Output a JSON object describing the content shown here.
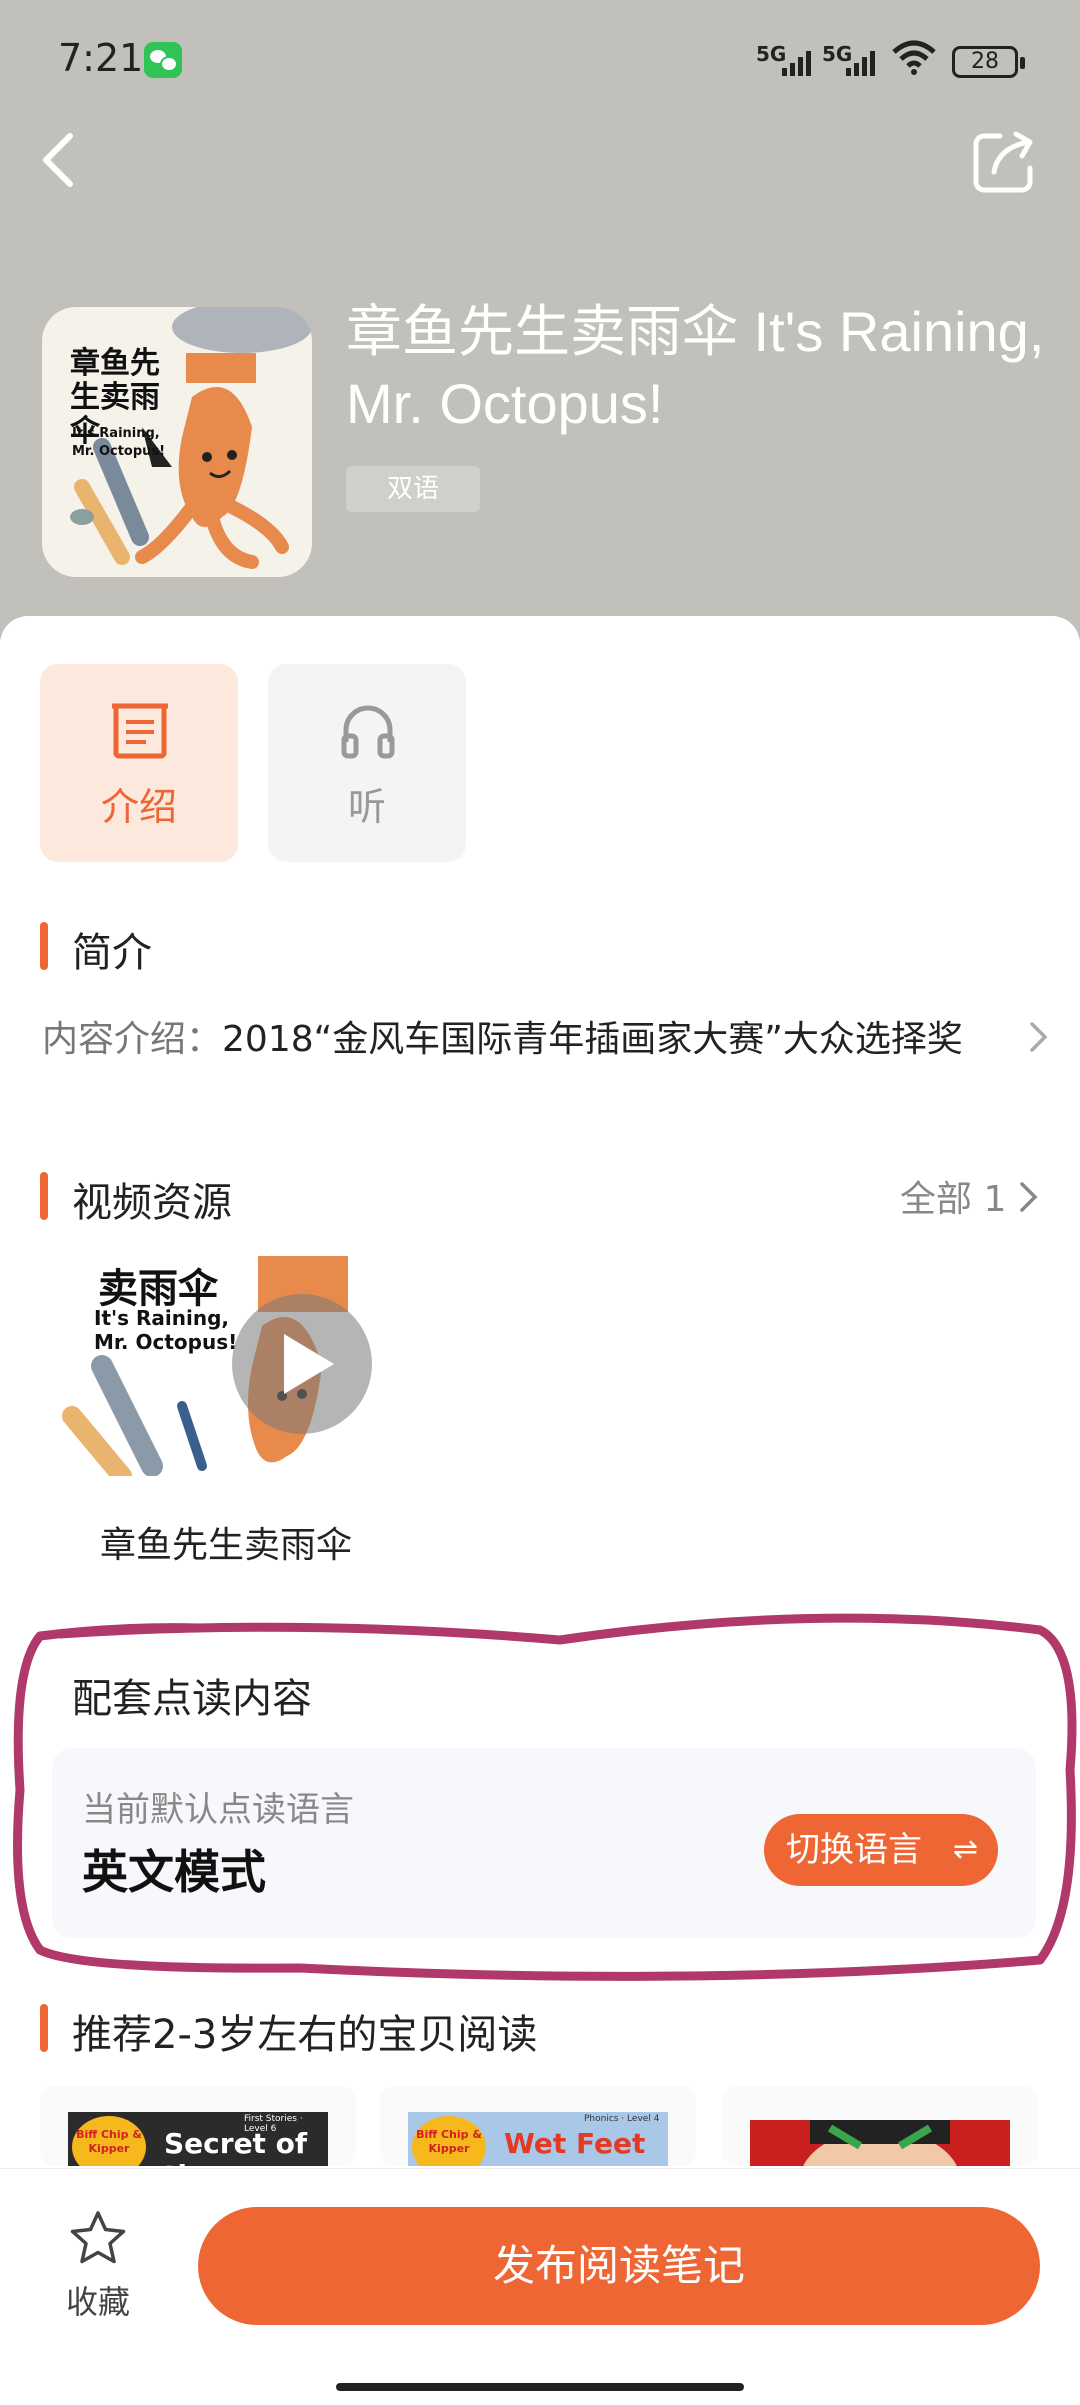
{
  "status_bar": {
    "time": "7:21",
    "signal1": "5G",
    "signal2": "5G",
    "battery": "28"
  },
  "book": {
    "title": "章鱼先生卖雨伞 It's Raining, Mr. Octopus!",
    "tag": "双语",
    "cover_title_cn": "章鱼先生卖雨伞",
    "cover_title_en": "It's Raining, Mr. Octopus!"
  },
  "tabs": [
    {
      "label": "介绍",
      "icon": "document-icon",
      "active": true
    },
    {
      "label": "听",
      "icon": "headphones-icon",
      "active": false
    }
  ],
  "intro": {
    "section_title": "简介",
    "label": "内容介绍：",
    "text": "2018“金风车国际青年插画家大赛”大众选择奖"
  },
  "videos": {
    "section_title": "视频资源",
    "all_label": "全部 1",
    "thumb_title_cn": "卖雨伞",
    "thumb_title_en": "It's Raining, Mr. Octopus!",
    "caption": "章鱼先生卖雨伞"
  },
  "read_point": {
    "section_title": "配套点读内容",
    "subtitle": "当前默认点读语言",
    "mode": "英文模式",
    "switch_label": "切换语言",
    "switch_icon": "⇌"
  },
  "recommend": {
    "section_title": "推荐2-3岁左右的宝贝阅读",
    "books": [
      {
        "title": "Secret of the",
        "badge": "Biff Chip & Kipper",
        "level": "First Stories · Level 6",
        "color": "#2b2b2b"
      },
      {
        "title": "Wet Feet",
        "badge": "Biff Chip & Kipper",
        "level": "Phonics · Level 4",
        "color": "#a9c8e8"
      },
      {
        "title": "",
        "badge": "",
        "level": "",
        "color": "#c8201f"
      }
    ]
  },
  "bottom": {
    "favorite_label": "收藏",
    "publish_label": "发布阅读笔记"
  },
  "colors": {
    "accent": "#ee6633",
    "header_bg": "#c1c0bb",
    "annotation": "#b0386a"
  }
}
